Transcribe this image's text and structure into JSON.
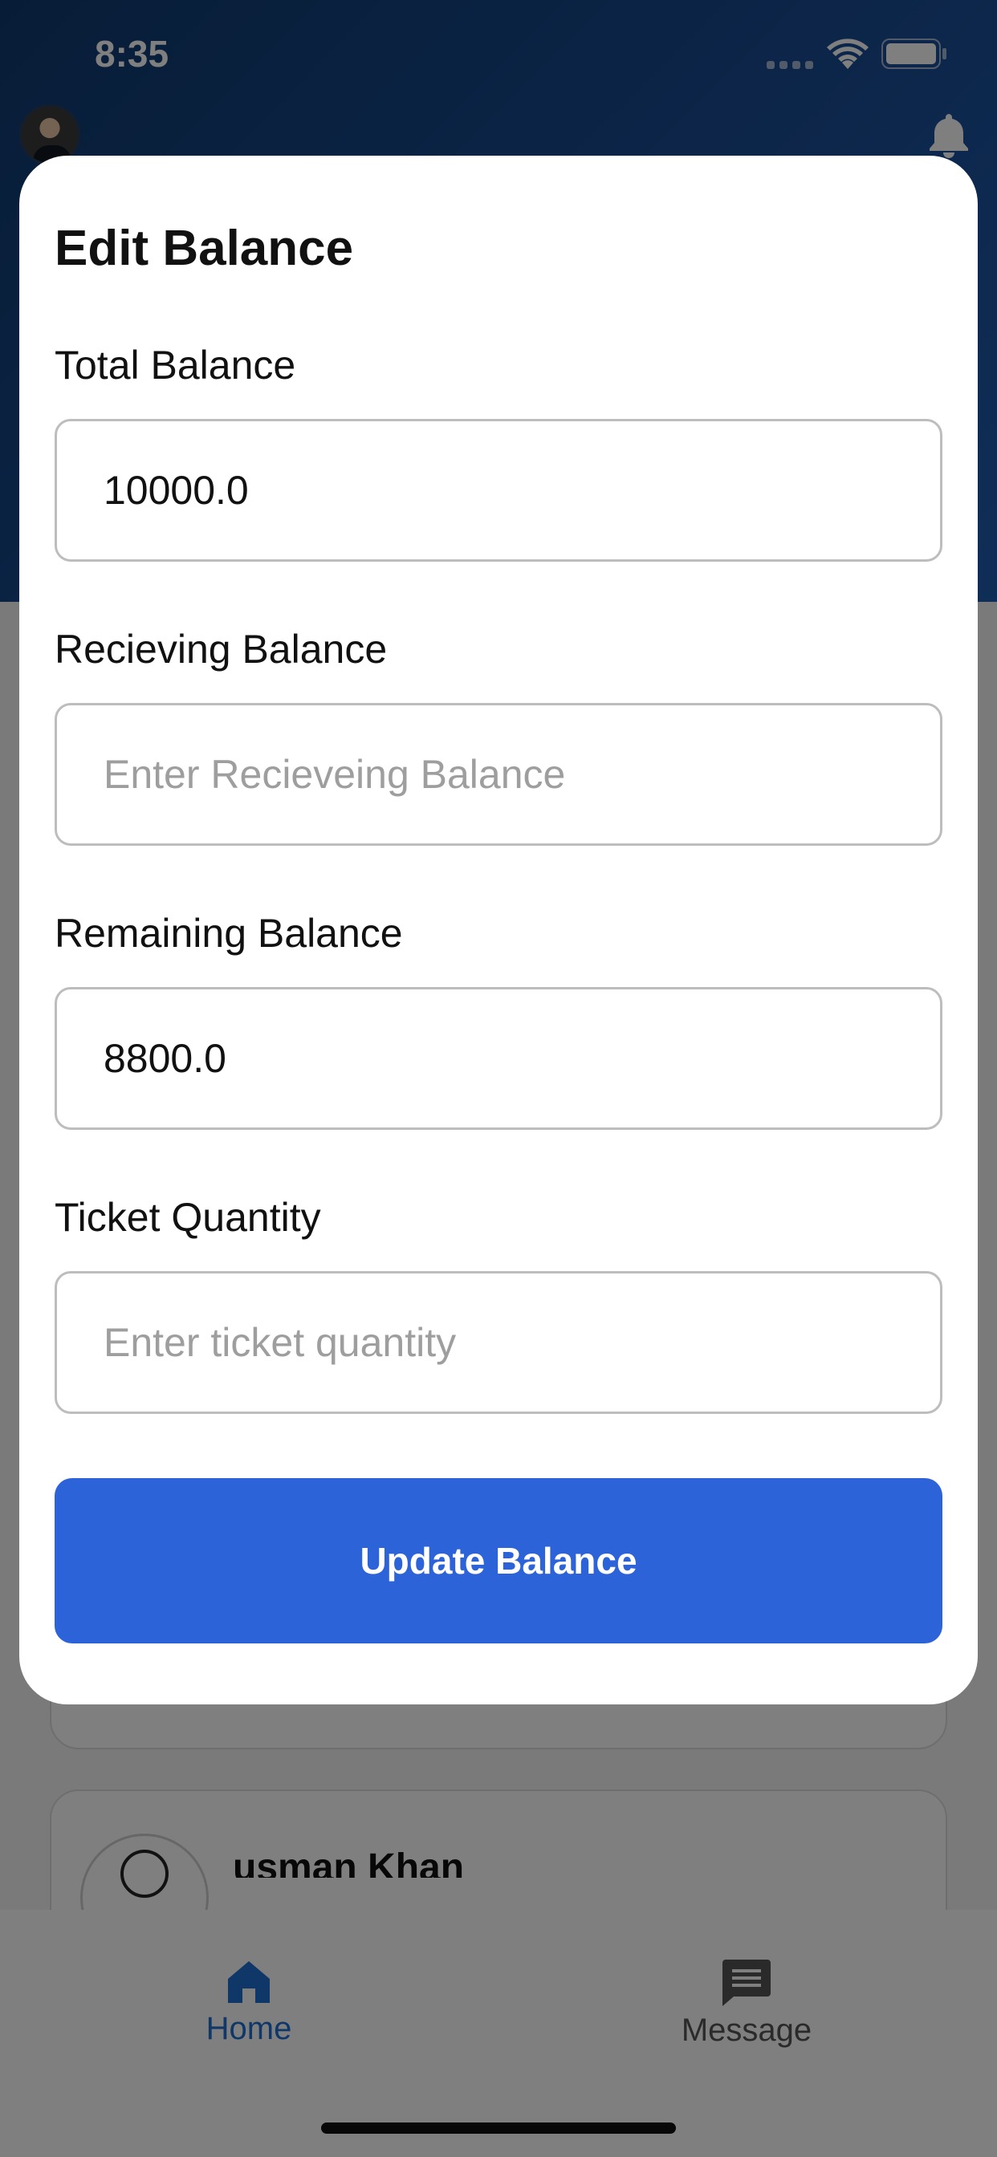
{
  "status_bar": {
    "time": "8:35"
  },
  "background": {
    "list_item_name": "usman Khan"
  },
  "bottom_nav": {
    "items": [
      {
        "label": "Home",
        "icon": "home-icon",
        "active": true
      },
      {
        "label": "Message",
        "icon": "message-icon",
        "active": false
      }
    ]
  },
  "modal": {
    "title": "Edit Balance",
    "fields": [
      {
        "label": "Total Balance",
        "value": "10000.0",
        "placeholder": ""
      },
      {
        "label": "Recieving Balance",
        "value": "",
        "placeholder": "Enter Recieveing Balance"
      },
      {
        "label": "Remaining Balance",
        "value": "8800.0",
        "placeholder": ""
      },
      {
        "label": "Ticket Quantity",
        "value": "",
        "placeholder": "Enter ticket quantity"
      }
    ],
    "submit_label": "Update Balance"
  },
  "colors": {
    "header_gradient_start": "#0f3a6e",
    "primary_button": "#2c63d8",
    "active_nav": "#1f6fd1"
  }
}
